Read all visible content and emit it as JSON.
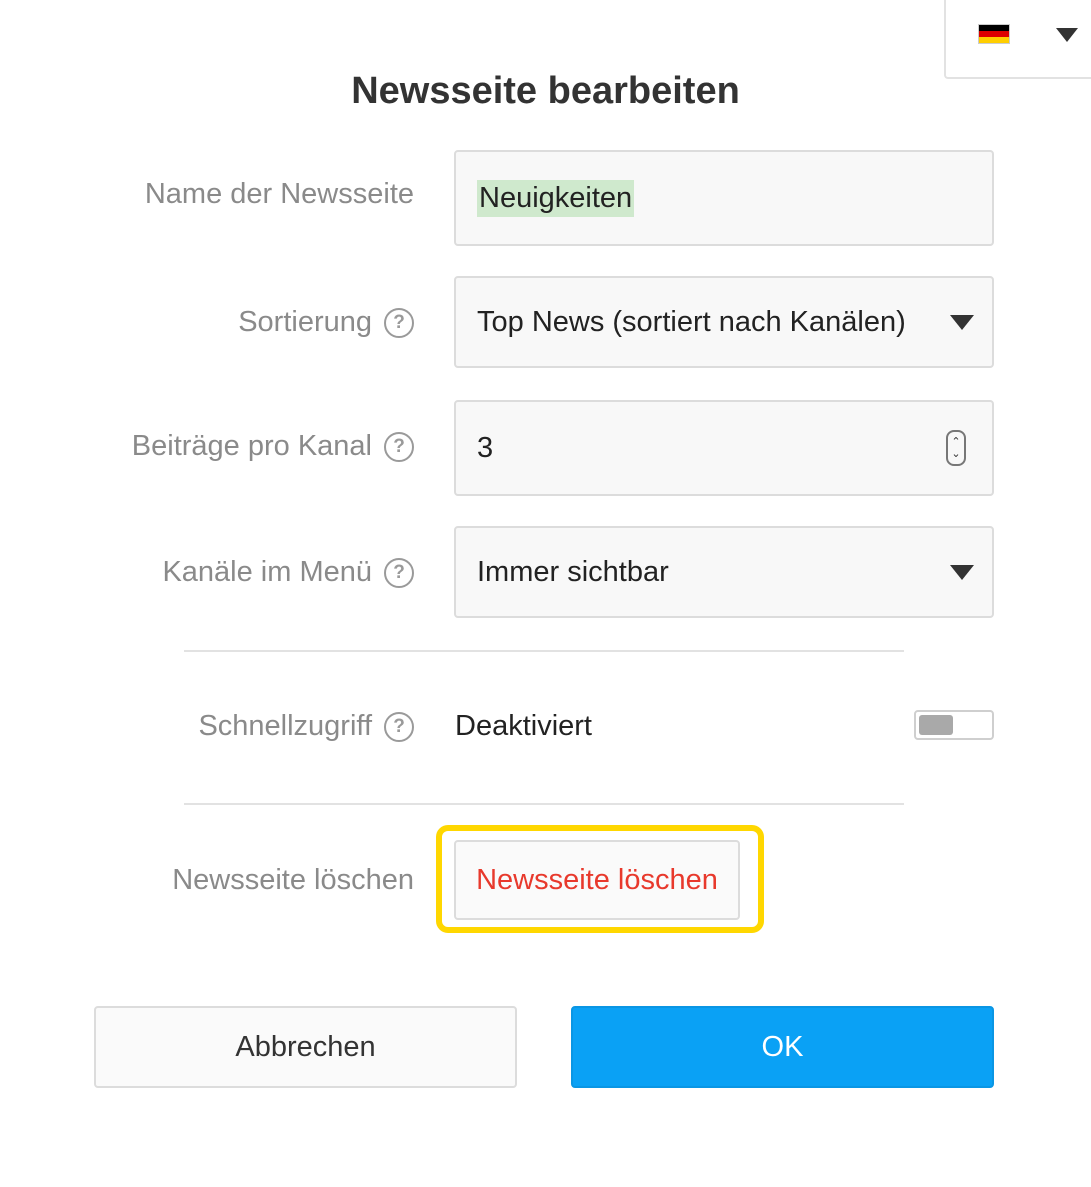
{
  "colors": {
    "accent": "#0aa1f5",
    "danger": "#e8392c",
    "highlight": "#ffd700",
    "selection": "#cfe9cd"
  },
  "language": {
    "flag": "germany-flag",
    "flag_colors": [
      "#000000",
      "#dd0000",
      "#ffce00"
    ]
  },
  "dialog": {
    "title": "Newsseite bearbeiten"
  },
  "fields": {
    "name": {
      "label": "Name der Newsseite",
      "value": "Neuigkeiten"
    },
    "sort": {
      "label": "Sortierung",
      "help": "?",
      "value": "Top News (sortiert nach Kanälen)"
    },
    "posts_per_channel": {
      "label": "Beiträge pro Kanal",
      "help": "?",
      "value": "3"
    },
    "channels_menu": {
      "label": "Kanäle im Menü",
      "help": "?",
      "value": "Immer sichtbar"
    },
    "quick_access": {
      "label": "Schnellzugriff",
      "help": "?",
      "value": "Deaktiviert",
      "enabled": false
    },
    "delete": {
      "label": "Newsseite löschen",
      "button": "Newsseite löschen"
    }
  },
  "buttons": {
    "cancel": "Abbrechen",
    "ok": "OK"
  }
}
